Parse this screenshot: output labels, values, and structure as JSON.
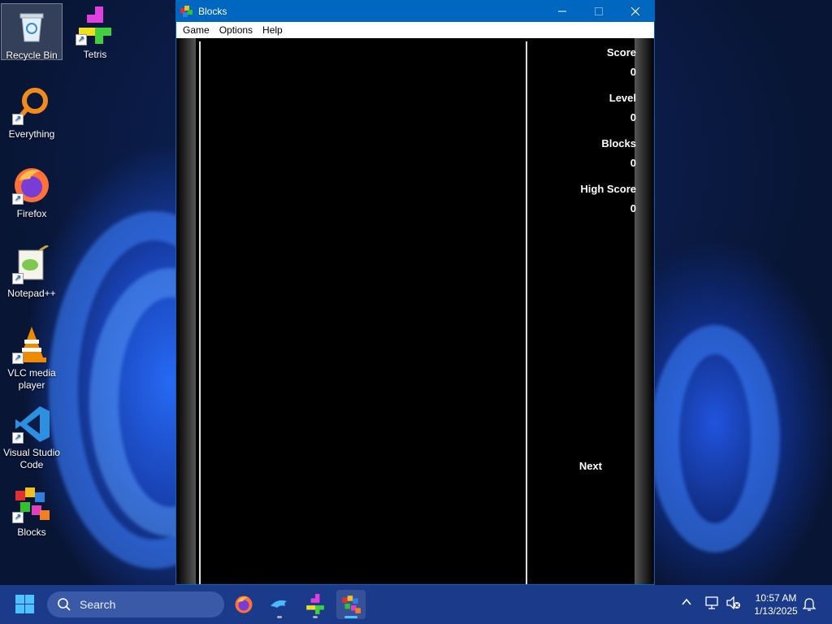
{
  "desktop": {
    "icons": [
      {
        "label": "Recycle Bin"
      },
      {
        "label": "Tetris"
      },
      {
        "label": "Everything"
      },
      {
        "label": "Firefox"
      },
      {
        "label": "Notepad++"
      },
      {
        "label": "VLC media player"
      },
      {
        "label": "Visual Studio Code"
      },
      {
        "label": "Blocks"
      }
    ]
  },
  "window": {
    "title": "Blocks",
    "menu": [
      "Game",
      "Options",
      "Help"
    ],
    "stats": {
      "score_label": "Score",
      "score_value": "0",
      "level_label": "Level",
      "level_value": "0",
      "blocks_label": "Blocks",
      "blocks_value": "0",
      "high_label": "High Score",
      "high_value": "0",
      "next_label": "Next"
    }
  },
  "taskbar": {
    "search_placeholder": "Search",
    "time": "10:57 AM",
    "date": "1/13/2025"
  },
  "colors": {
    "titlebar": "#0067c0",
    "taskbar": "#1b3a8a",
    "accent": "#4cc2ff"
  }
}
